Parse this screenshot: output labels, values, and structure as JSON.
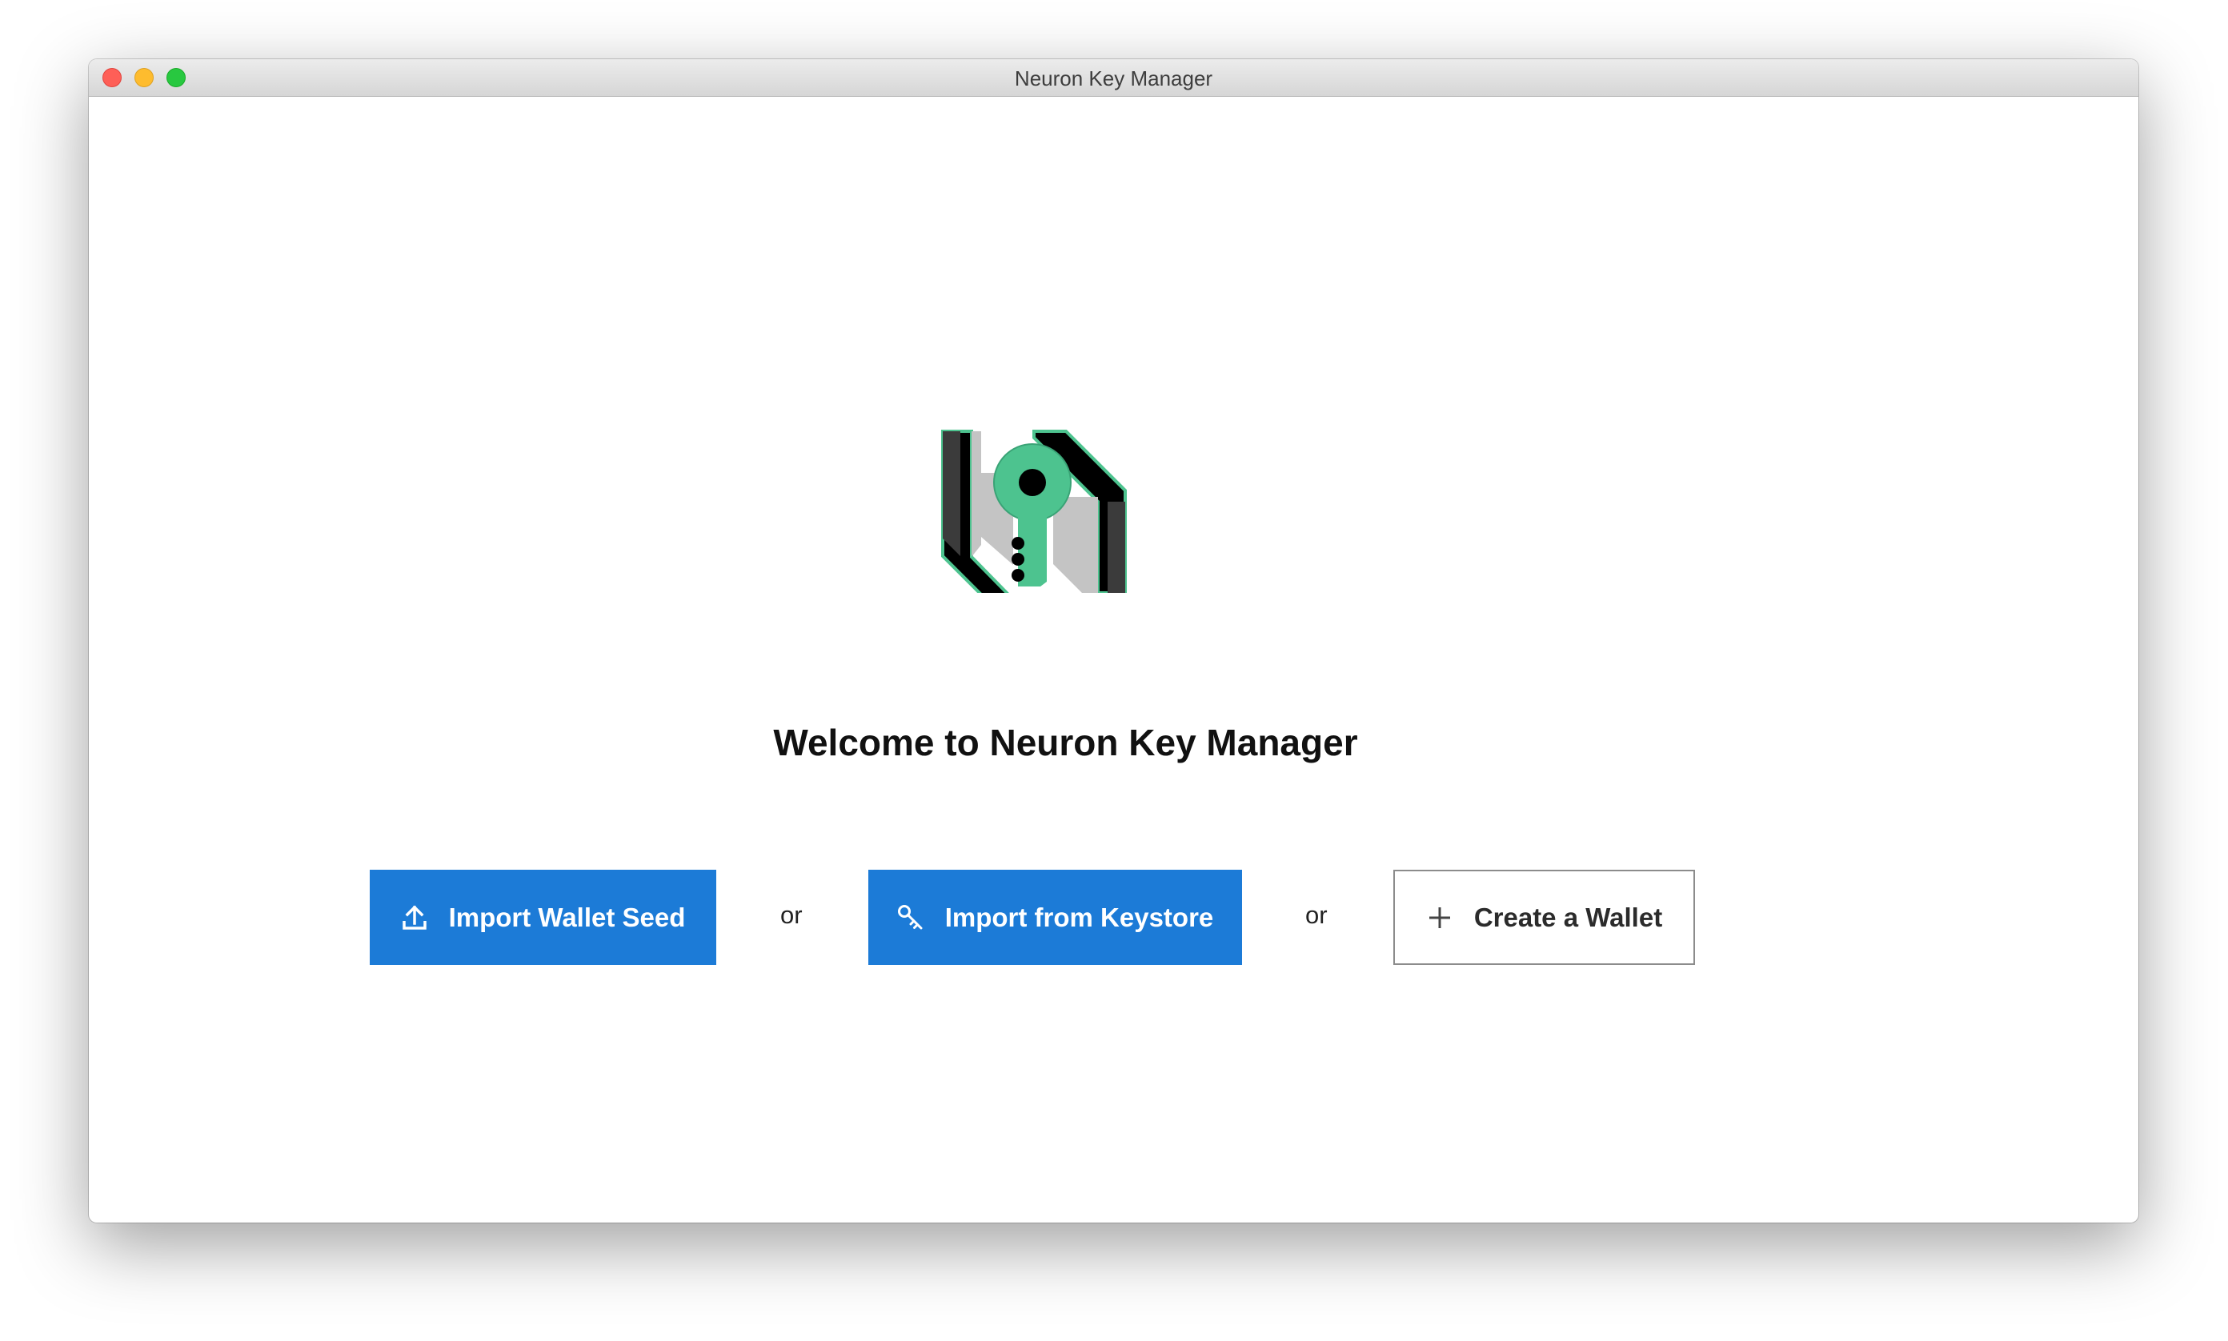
{
  "window": {
    "title": "Neuron Key Manager"
  },
  "welcome": {
    "heading": "Welcome to Neuron Key Manager",
    "logo_icon": "neuron-key-logo",
    "logo_colors": {
      "accent": "#4dc38f",
      "dark": "#3b3b3b",
      "light": "#c4c4c4",
      "black": "#000000"
    }
  },
  "actions": {
    "import_seed": {
      "label": "Import Wallet Seed",
      "icon": "upload-icon"
    },
    "separator_1": "or",
    "import_keystore": {
      "label": "Import from Keystore",
      "icon": "key-icon"
    },
    "separator_2": "or",
    "create_wallet": {
      "label": "Create a Wallet",
      "icon": "plus-icon"
    }
  },
  "colors": {
    "primary_button": "#1c7bd7",
    "secondary_border": "#8c8c8c"
  }
}
